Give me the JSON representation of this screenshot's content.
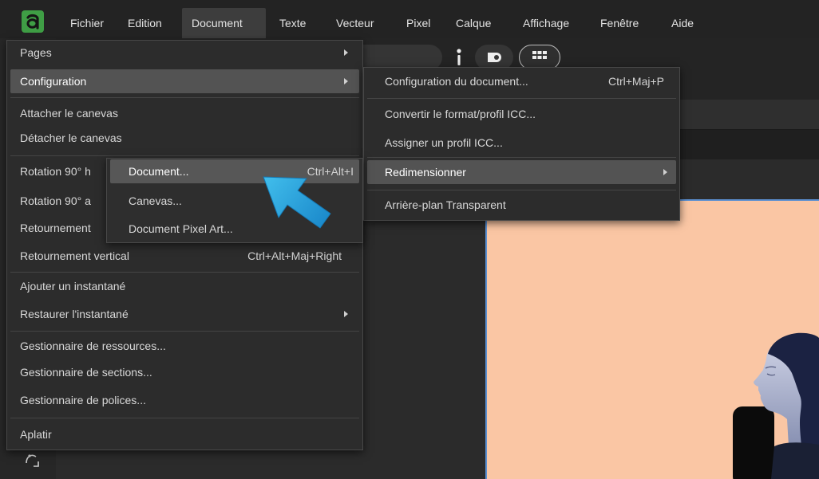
{
  "menubar": {
    "logo_icon": "affinity-logo-icon",
    "items": [
      {
        "label": "Fichier"
      },
      {
        "label": "Edition"
      },
      {
        "label": "Document",
        "active": true
      },
      {
        "label": "Texte"
      },
      {
        "label": "Vecteur"
      },
      {
        "label": "Pixel"
      },
      {
        "label": "Calque"
      },
      {
        "label": "Affichage"
      },
      {
        "label": "Fenêtre"
      },
      {
        "label": "Aide"
      }
    ]
  },
  "toolbar": {
    "icons": [
      "more-icon",
      "toggle-icon",
      "grid-icon"
    ]
  },
  "left_toolbar": {
    "icons": [
      "node-tool-icon"
    ]
  },
  "document_menu": {
    "items": [
      {
        "label": "Pages",
        "has_submenu": true
      },
      {
        "label": "Configuration",
        "has_submenu": true,
        "highlighted": true
      },
      {
        "label": "Attacher le canevas"
      },
      {
        "label": "Détacher le canevas"
      },
      {
        "label": "Rotation 90° h"
      },
      {
        "label": "Rotation 90° a"
      },
      {
        "label": "Retournement"
      },
      {
        "label": "Retournement vertical",
        "shortcut": "Ctrl+Alt+Maj+Right"
      },
      {
        "label": "Ajouter un instantané"
      },
      {
        "label": "Restaurer l'instantané",
        "has_submenu": true
      },
      {
        "label": "Gestionnaire de ressources..."
      },
      {
        "label": "Gestionnaire de sections..."
      },
      {
        "label": "Gestionnaire de polices..."
      },
      {
        "label": "Aplatir"
      }
    ]
  },
  "configuration_submenu": {
    "items": [
      {
        "label": "Configuration du document...",
        "shortcut": "Ctrl+Maj+P"
      },
      {
        "label": "Convertir le format/profil ICC..."
      },
      {
        "label": "Assigner un profil ICC..."
      },
      {
        "label": "Redimensionner",
        "has_submenu": true,
        "highlighted": true
      },
      {
        "label": "Arrière-plan Transparent"
      }
    ]
  },
  "redimensionner_submenu": {
    "items": [
      {
        "label": "Document...",
        "shortcut": "Ctrl+Alt+I",
        "highlighted": true
      },
      {
        "label": "Canevas..."
      },
      {
        "label": "Document Pixel Art..."
      }
    ]
  },
  "annotation": {
    "arrow_icon": "callout-arrow-icon",
    "color": "#2aa7df"
  },
  "colors": {
    "logo_green": "#3f9e45",
    "menubar_bg": "#232323",
    "menu_bg": "#2c2c2c",
    "menu_highlight": "#535353",
    "canvas_fill": "#fac6a4",
    "selection_outline": "#5b8fd0"
  }
}
